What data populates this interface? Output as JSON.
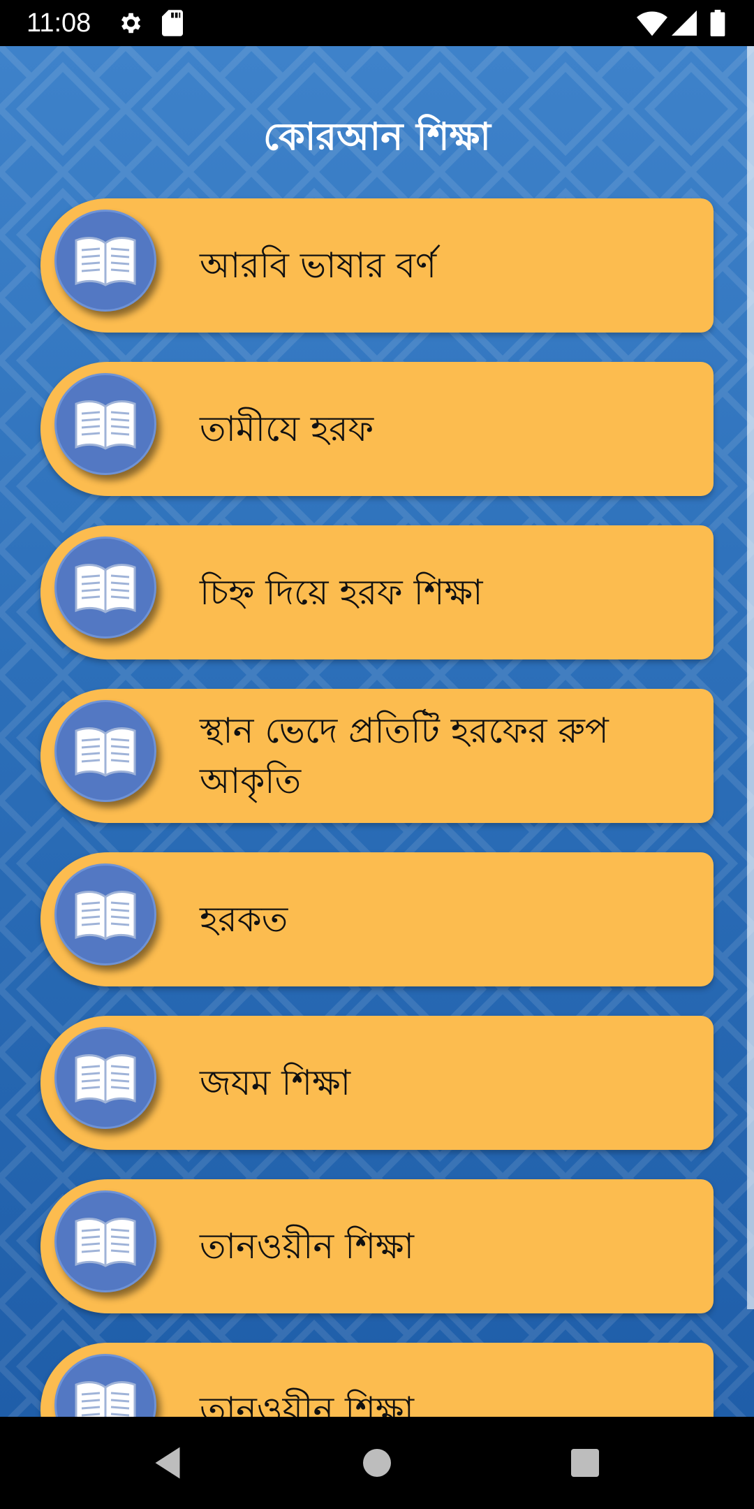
{
  "status_bar": {
    "time": "11:08",
    "icons": [
      "gear-icon",
      "sd-card-icon",
      "wifi-icon",
      "signal-icon",
      "battery-icon"
    ]
  },
  "app": {
    "title": "কোরআন শিক্ষা",
    "background_color": "#2c6fb9",
    "card_color": "#fcbc4f",
    "icon_circle_color": "#5378c3",
    "item_icon": "open-book-icon"
  },
  "menu": {
    "items": [
      {
        "label": "আরবি ভাষার বর্ণ"
      },
      {
        "label": "তামীযে হরফ"
      },
      {
        "label": "চিহ্ন দিয়ে হরফ শিক্ষা"
      },
      {
        "label": "স্থান ভেদে প্রতিটি হরফের রুপ আকৃতি"
      },
      {
        "label": "হরকত"
      },
      {
        "label": "জযম শিক্ষা"
      },
      {
        "label": "তানওয়ীন শিক্ষা"
      },
      {
        "label": "তানওয়ীন শিক্ষা"
      }
    ]
  },
  "nav_bar": {
    "back": "back-icon",
    "home": "home-icon",
    "recents": "recents-icon"
  }
}
